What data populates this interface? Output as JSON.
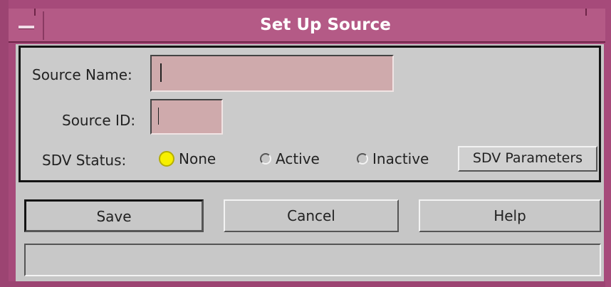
{
  "window": {
    "title": "Set Up Source",
    "menu_icon": "window-menu-icon"
  },
  "form": {
    "source_name_label": "Source Name:",
    "source_name_value": "",
    "source_id_label": "Source ID:",
    "source_id_value": "",
    "sdv_status_label": "SDV Status:",
    "sdv_options": [
      {
        "label": "None",
        "selected": true
      },
      {
        "label": "Active",
        "selected": false
      },
      {
        "label": "Inactive",
        "selected": false
      }
    ],
    "sdv_parameters_label": "SDV Parameters"
  },
  "actions": {
    "save_label": "Save",
    "cancel_label": "Cancel",
    "help_label": "Help"
  },
  "status_bar": {
    "message": ""
  },
  "colors": {
    "title_bar": "#b45a86",
    "input_bg": "#cfaaac",
    "radio_selected": "#f7f000"
  }
}
